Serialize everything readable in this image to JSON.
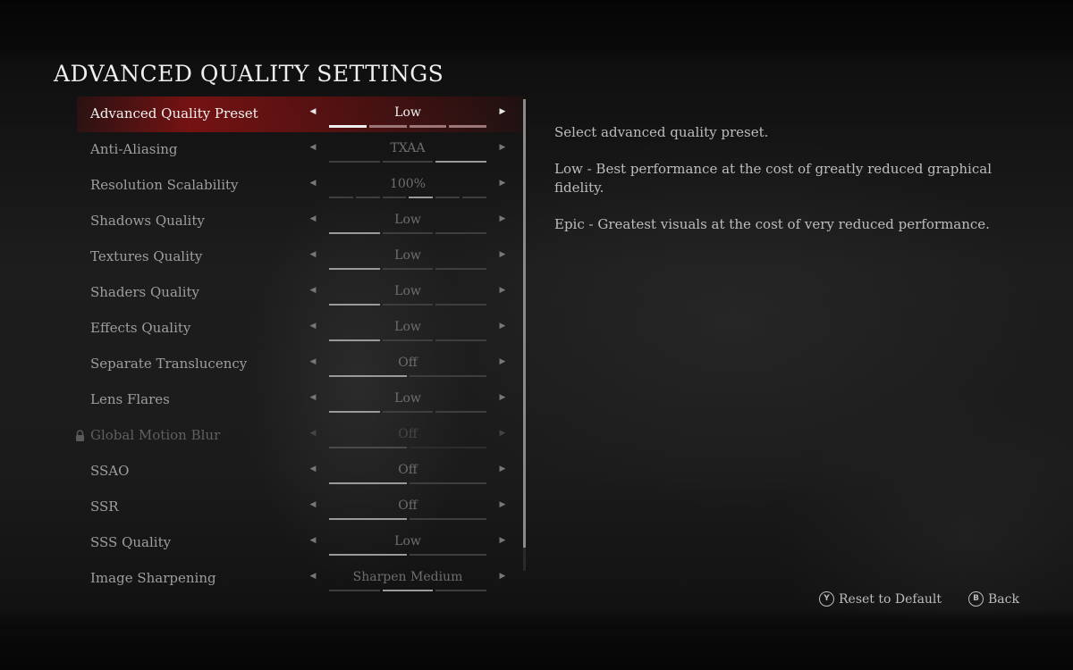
{
  "title": "ADVANCED QUALITY SETTINGS",
  "settings": [
    {
      "label": "Advanced Quality Preset",
      "value": "Low",
      "segments": 4,
      "active": [
        0
      ],
      "state": "selected"
    },
    {
      "label": "Anti-Aliasing",
      "value": "TXAA",
      "segments": 3,
      "active": [
        2
      ],
      "state": "normal"
    },
    {
      "label": "Resolution Scalability",
      "value": "100%",
      "segments": 6,
      "active": [
        3
      ],
      "state": "normal"
    },
    {
      "label": "Shadows Quality",
      "value": "Low",
      "segments": 3,
      "active": [
        0
      ],
      "state": "normal"
    },
    {
      "label": "Textures Quality",
      "value": "Low",
      "segments": 3,
      "active": [
        0
      ],
      "state": "normal"
    },
    {
      "label": "Shaders Quality",
      "value": "Low",
      "segments": 3,
      "active": [
        0
      ],
      "state": "normal"
    },
    {
      "label": "Effects Quality",
      "value": "Low",
      "segments": 3,
      "active": [
        0
      ],
      "state": "normal"
    },
    {
      "label": "Separate Translucency",
      "value": "Off",
      "segments": 2,
      "active": [
        0
      ],
      "state": "normal"
    },
    {
      "label": "Lens Flares",
      "value": "Low",
      "segments": 3,
      "active": [
        0
      ],
      "state": "normal"
    },
    {
      "label": "Global Motion Blur",
      "value": "Off",
      "segments": 2,
      "active": [
        0
      ],
      "state": "disabled",
      "locked": true
    },
    {
      "label": "SSAO",
      "value": "Off",
      "segments": 2,
      "active": [
        0
      ],
      "state": "normal"
    },
    {
      "label": "SSR",
      "value": "Off",
      "segments": 2,
      "active": [
        0
      ],
      "state": "normal"
    },
    {
      "label": "SSS Quality",
      "value": "Low",
      "segments": 2,
      "active": [
        0
      ],
      "state": "normal"
    },
    {
      "label": "Image Sharpening",
      "value": "Sharpen Medium",
      "segments": 3,
      "active": [
        1
      ],
      "state": "normal"
    }
  ],
  "description": [
    "Select advanced quality preset.",
    "Low - Best performance at the cost of greatly reduced graphical fidelity.",
    "Epic - Greatest visuals at the cost of very reduced performance."
  ],
  "footer": {
    "reset_button": "Y",
    "reset_label": "Reset to Default",
    "back_button": "B",
    "back_label": "Back"
  },
  "scroll_visible_fraction": 0.95,
  "colors": {
    "accent": "#961212",
    "text": "#bdbdbd",
    "title": "#efefef"
  }
}
